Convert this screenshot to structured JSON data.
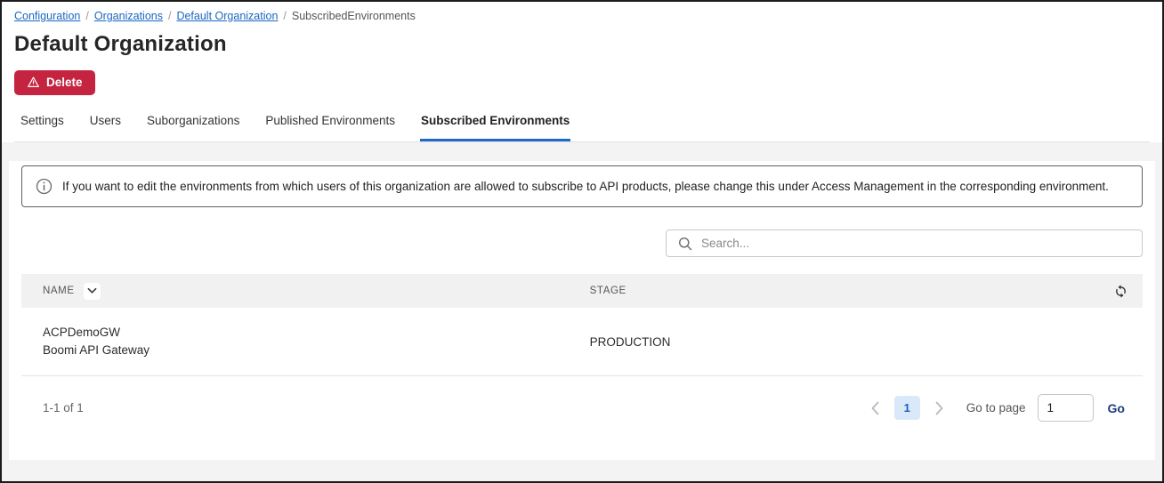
{
  "breadcrumb": {
    "separator": "/",
    "items": [
      {
        "label": "Configuration"
      },
      {
        "label": "Organizations"
      },
      {
        "label": "Default Organization"
      },
      {
        "label": "SubscribedEnvironments"
      }
    ]
  },
  "page": {
    "title": "Default Organization"
  },
  "actions": {
    "delete_label": "Delete"
  },
  "tabs": [
    {
      "label": "Settings",
      "active": false
    },
    {
      "label": "Users",
      "active": false
    },
    {
      "label": "Suborganizations",
      "active": false
    },
    {
      "label": "Published Environments",
      "active": false
    },
    {
      "label": "Subscribed Environments",
      "active": true
    }
  ],
  "banner": {
    "text": "If you want to edit the environments from which users of this organization are allowed to subscribe to API products, please change this under Access Management in the corresponding environment."
  },
  "search": {
    "placeholder": "Search..."
  },
  "table": {
    "columns": {
      "name": "NAME",
      "stage": "STAGE"
    },
    "rows": [
      {
        "name_line1": "ACPDemoGW",
        "name_line2": "Boomi API Gateway",
        "stage": "PRODUCTION"
      }
    ]
  },
  "pagination": {
    "summary": "1-1 of 1",
    "current_page": "1",
    "go_to_page_label": "Go to page",
    "page_input_value": "1",
    "go_button_label": "Go"
  },
  "colors": {
    "link_blue": "#1a66c2",
    "tab_accent_blue": "#1f69cb",
    "delete_red": "#c4243f",
    "page_chip_bg": "#d9e9f9",
    "page_chip_text": "#1a5fc0",
    "go_navy": "#1c3e7d",
    "table_header_bg": "#f1f1f1"
  }
}
